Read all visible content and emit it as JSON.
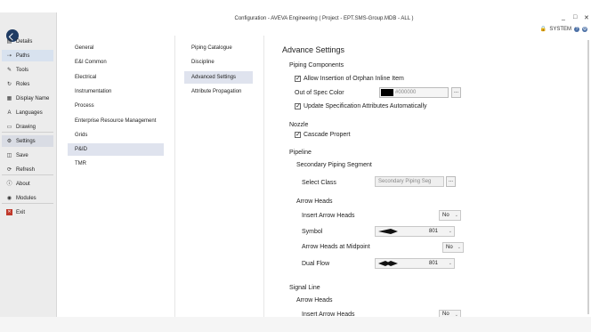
{
  "titlebar": {
    "title": "Configuration - AVEVA Engineering ( Project - EPT.SMS-Group.MDB - ALL )",
    "minimize": "_",
    "maximize": "□",
    "close": "✕"
  },
  "sysbar": {
    "user": "SYSTEM",
    "help": "?"
  },
  "nav": [
    {
      "label": "Details",
      "icon": "details-icon",
      "glyph": "▤"
    },
    {
      "label": "Paths",
      "icon": "paths-icon",
      "glyph": "⇢"
    },
    {
      "label": "Tools",
      "icon": "tools-icon",
      "glyph": "✎"
    },
    {
      "label": "Roles",
      "icon": "roles-icon",
      "glyph": "↻"
    },
    {
      "label": "Display Name",
      "icon": "display-name-icon",
      "glyph": "▦"
    },
    {
      "label": "Languages",
      "icon": "languages-icon",
      "glyph": "A"
    },
    {
      "label": "Drawing",
      "icon": "drawing-icon",
      "glyph": "▭"
    },
    {
      "label": "Settings",
      "icon": "gear-icon",
      "glyph": "⚙"
    },
    {
      "label": "Save",
      "icon": "save-icon",
      "glyph": "◫"
    },
    {
      "label": "Refresh",
      "icon": "refresh-icon",
      "glyph": "⟳"
    },
    {
      "label": "About",
      "icon": "info-icon",
      "glyph": "ⓘ"
    },
    {
      "label": "Modules",
      "icon": "modules-icon",
      "glyph": "◉"
    },
    {
      "label": "Exit",
      "icon": "exit-icon",
      "glyph": "✕"
    }
  ],
  "categories": [
    "General",
    "E&I Common",
    "Electrical",
    "Instrumentation",
    "Process",
    "Enterprise Resource Management",
    "Grids",
    "P&ID",
    "TMR"
  ],
  "subcategories": [
    "Piping Catalogue",
    "Discipline",
    "Advanced Settings",
    "Attribute Propagation"
  ],
  "settings": {
    "heading": "Advance Settings",
    "piping_components": {
      "title": "Piping Components",
      "allow_orphan": "Allow Insertion of Orphan Inline Item",
      "out_of_spec": "Out of Spec Color",
      "color_value": "#000000",
      "browse": "...",
      "update_spec": "Update Specification Attributes Automatically"
    },
    "nozzle": {
      "title": "Nozzle",
      "cascade": "Cascade Propert"
    },
    "pipeline": {
      "title": "Pipeline",
      "secondary": "Secondary Piping Segment",
      "select_class": "Select Class",
      "class_value": "Secondary Piping Seg",
      "browse": "...",
      "arrow_heads": "Arrow Heads",
      "insert_arrow": "Insert Arrow Heads",
      "insert_arrow_value": "No",
      "symbol": "Symbol",
      "symbol_value": "801",
      "midpoint": "Arrow Heads at Midpoint",
      "midpoint_value": "No",
      "dual_flow": "Dual Flow",
      "dual_flow_value": "801"
    },
    "signal_line": {
      "title": "Signal Line",
      "arrow_heads": "Arrow Heads",
      "insert_arrow": "Insert Arrow Heads",
      "insert_arrow_value": "No"
    }
  }
}
